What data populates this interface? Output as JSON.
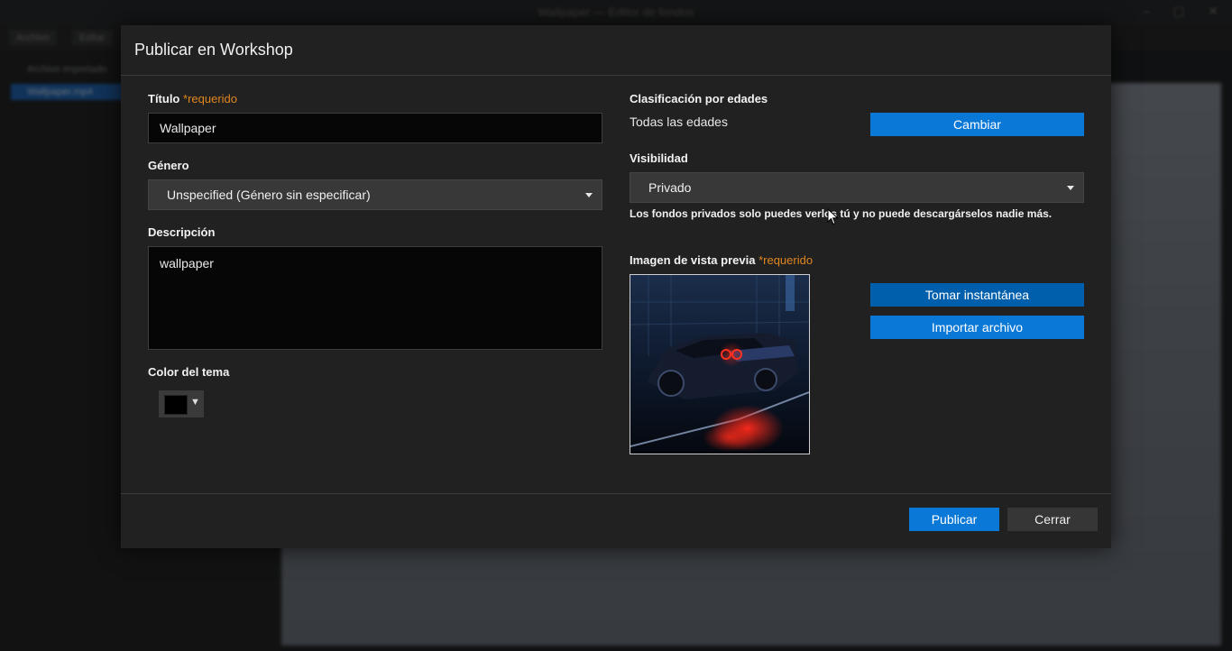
{
  "background": {
    "window_title": "Wallpaper — Editor de fondos",
    "window_controls": [
      "–",
      "▢",
      "✕"
    ],
    "menus": [
      "Archivo",
      "Editar"
    ],
    "sidebar_items": [
      "Archivo importado",
      "Wallpaper.mp4"
    ]
  },
  "dialog": {
    "title": "Publicar en Workshop",
    "left": {
      "title_label": "Título",
      "required_mark": "*requerido",
      "title_value": "Wallpaper",
      "genre_label": "Género",
      "genre_value": "Unspecified (Género sin especificar)",
      "description_label": "Descripción",
      "description_value": "wallpaper",
      "theme_color_label": "Color del tema",
      "theme_color": "#000000"
    },
    "right": {
      "age_rating_label": "Clasificación por edades",
      "age_rating_value": "Todas las edades",
      "change_button": "Cambiar",
      "visibility_label": "Visibilidad",
      "visibility_value": "Privado",
      "visibility_hint": "Los fondos privados solo puedes verlos tú y no puede descargárselos nadie más.",
      "preview_label": "Imagen de vista previa",
      "required_mark": "*requerido",
      "snapshot_button": "Tomar instantánea",
      "import_button": "Importar archivo"
    },
    "footer": {
      "publish_button": "Publicar",
      "close_button": "Cerrar"
    }
  },
  "colors": {
    "accent_blue": "#0a78d7",
    "required_orange": "#e0861f"
  }
}
